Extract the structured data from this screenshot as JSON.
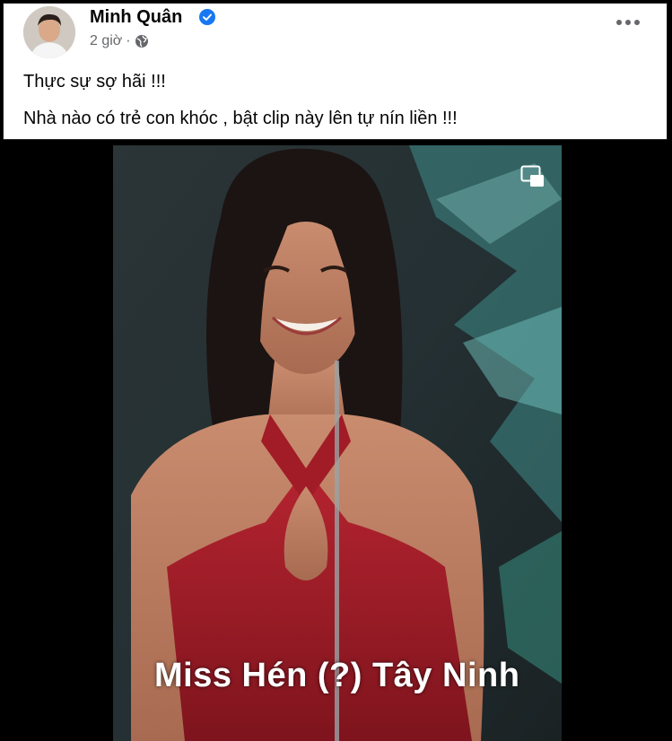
{
  "post": {
    "author": "Minh Quân",
    "time": "2 giờ",
    "separator": "·",
    "lines": [
      "Thực sự sợ hãi !!!",
      "Nhà nào có trẻ con khóc , bật clip này lên tự nín liền !!!"
    ]
  },
  "video": {
    "caption": "Miss Hén (?) Tây Ninh"
  },
  "icons": {
    "verified": "verified-badge-icon",
    "audience": "globe-icon",
    "menu": "more-options-icon",
    "pip": "picture-in-picture-icon"
  },
  "colors": {
    "verified_blue": "#1877f2",
    "text_primary": "#050505",
    "text_secondary": "#65676b",
    "dress_red": "#9e1a24"
  }
}
